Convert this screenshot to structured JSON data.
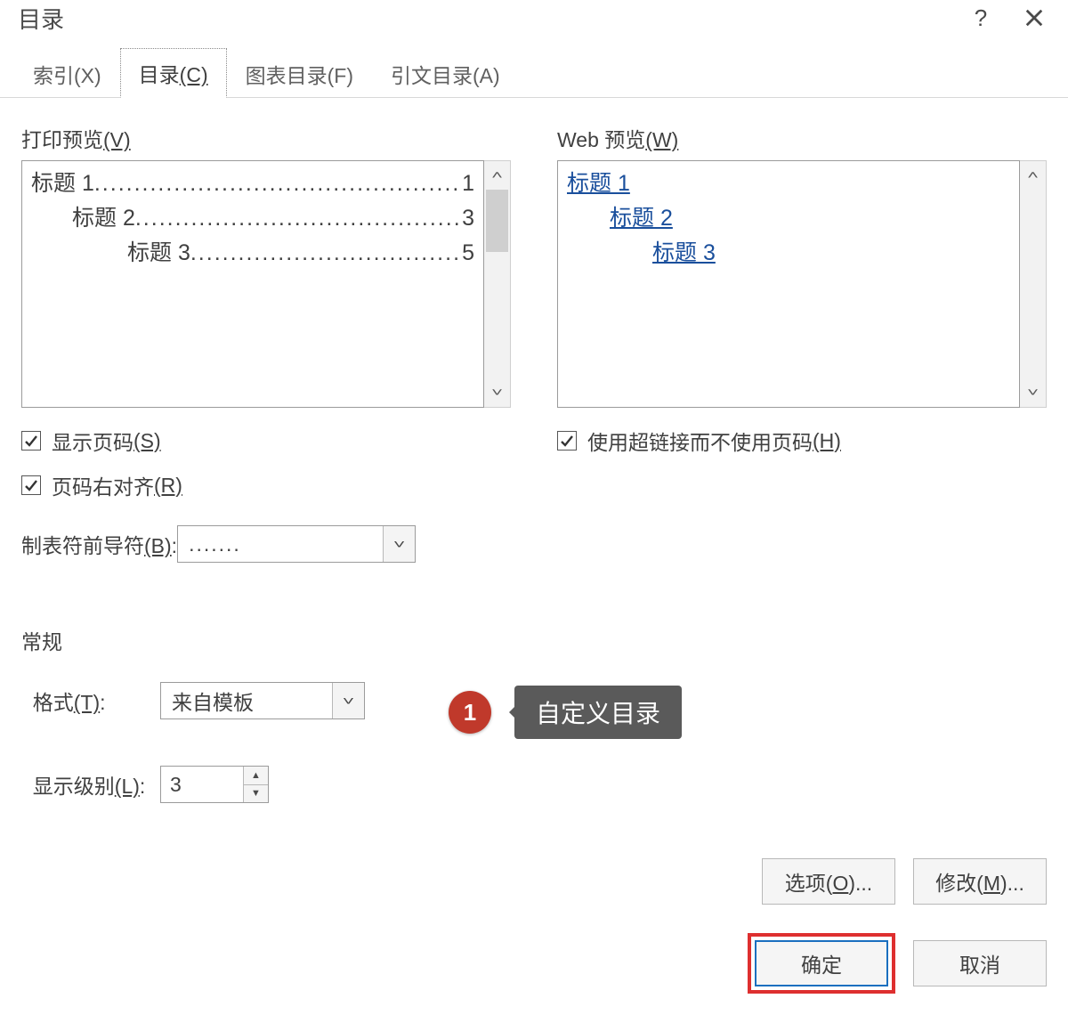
{
  "titlebar": {
    "title": "目录",
    "help": "?",
    "close": "✕"
  },
  "tabs": [
    {
      "label": "索引",
      "accelerator": "(X)"
    },
    {
      "label": "目录",
      "accelerator": "(C)"
    },
    {
      "label": "图表目录",
      "accelerator": "(F)"
    },
    {
      "label": "引文目录",
      "accelerator": "(A)"
    }
  ],
  "print_preview": {
    "label": "打印预览",
    "accelerator": "(V)",
    "lines": [
      {
        "title": "标题 1",
        "page": "1",
        "indent": 0
      },
      {
        "title": "标题 2",
        "page": "3",
        "indent": 1
      },
      {
        "title": "标题 3",
        "page": "5",
        "indent": 2
      }
    ]
  },
  "web_preview": {
    "label": "Web 预览",
    "accelerator": "(W)",
    "lines": [
      {
        "title": "标题 1",
        "indent": 0
      },
      {
        "title": "标题 2",
        "indent": 1
      },
      {
        "title": "标题 3",
        "indent": 2
      }
    ]
  },
  "checks": {
    "show_page_numbers": {
      "label": "显示页码",
      "ak": "(S)",
      "checked": true
    },
    "right_align_page_numbers": {
      "label": "页码右对齐",
      "ak": "(R)",
      "checked": true
    },
    "use_hyperlinks": {
      "label": "使用超链接而不使用页码",
      "ak": "(H)",
      "checked": true
    }
  },
  "tab_leader": {
    "label": "制表符前导符",
    "ak": "(B)",
    "value": "......."
  },
  "general": {
    "title": "常规",
    "format": {
      "label": "格式",
      "ak": "(T)",
      "value": "来自模板"
    },
    "levels": {
      "label": "显示级别",
      "ak": "(L)",
      "value": "3"
    }
  },
  "callout": {
    "index": "1",
    "text": "自定义目录"
  },
  "buttons": {
    "options": "选项(O)...",
    "modify": "修改(M)...",
    "ok": "确定",
    "cancel": "取消"
  },
  "dots_fill": "................................................................"
}
